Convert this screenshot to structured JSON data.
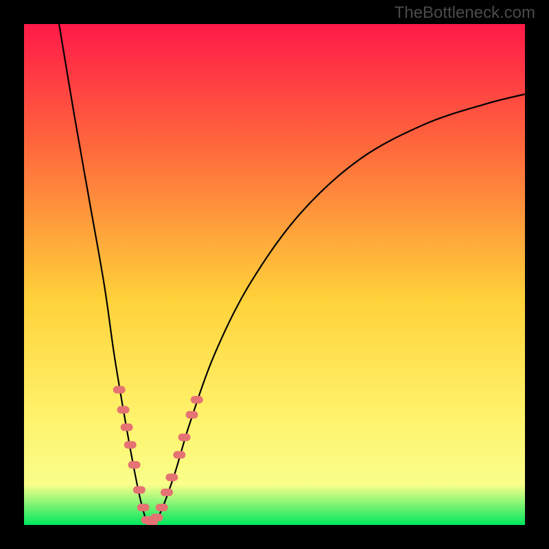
{
  "watermark": "TheBottleneck.com",
  "chart_data": {
    "type": "line",
    "title": "",
    "xlabel": "",
    "ylabel": "",
    "xlim": [
      0,
      100
    ],
    "ylim": [
      0,
      100
    ],
    "gradient": {
      "top": "#ff1a48",
      "upper_mid": "#ff6a3c",
      "mid": "#ffd23a",
      "lower_mid": "#fff26a",
      "lower": "#f9ff8a",
      "bottom": "#00e85c"
    },
    "series": [
      {
        "name": "bottleneck-curve",
        "points": [
          {
            "x": 7,
            "y": 100
          },
          {
            "x": 10,
            "y": 82
          },
          {
            "x": 13,
            "y": 65
          },
          {
            "x": 16,
            "y": 48
          },
          {
            "x": 18,
            "y": 34
          },
          {
            "x": 20,
            "y": 22
          },
          {
            "x": 22,
            "y": 11
          },
          {
            "x": 23.5,
            "y": 4
          },
          {
            "x": 25,
            "y": 0
          },
          {
            "x": 27,
            "y": 2
          },
          {
            "x": 30,
            "y": 10
          },
          {
            "x": 33,
            "y": 20
          },
          {
            "x": 38,
            "y": 34
          },
          {
            "x": 45,
            "y": 48
          },
          {
            "x": 55,
            "y": 62
          },
          {
            "x": 67,
            "y": 73
          },
          {
            "x": 80,
            "y": 80
          },
          {
            "x": 92,
            "y": 84
          },
          {
            "x": 100,
            "y": 86
          }
        ]
      }
    ],
    "highlight_points": [
      {
        "x": 19.0,
        "y": 27
      },
      {
        "x": 19.8,
        "y": 23
      },
      {
        "x": 20.5,
        "y": 19.5
      },
      {
        "x": 21.2,
        "y": 16
      },
      {
        "x": 22.0,
        "y": 12
      },
      {
        "x": 23.0,
        "y": 7
      },
      {
        "x": 23.8,
        "y": 3.5
      },
      {
        "x": 24.6,
        "y": 1.0
      },
      {
        "x": 25.5,
        "y": 0.5
      },
      {
        "x": 26.5,
        "y": 1.5
      },
      {
        "x": 27.5,
        "y": 3.5
      },
      {
        "x": 28.5,
        "y": 6.5
      },
      {
        "x": 29.5,
        "y": 9.5
      },
      {
        "x": 31.0,
        "y": 14
      },
      {
        "x": 32.0,
        "y": 17.5
      },
      {
        "x": 33.5,
        "y": 22
      },
      {
        "x": 34.5,
        "y": 25
      }
    ],
    "highlight_color": "#e57373"
  }
}
